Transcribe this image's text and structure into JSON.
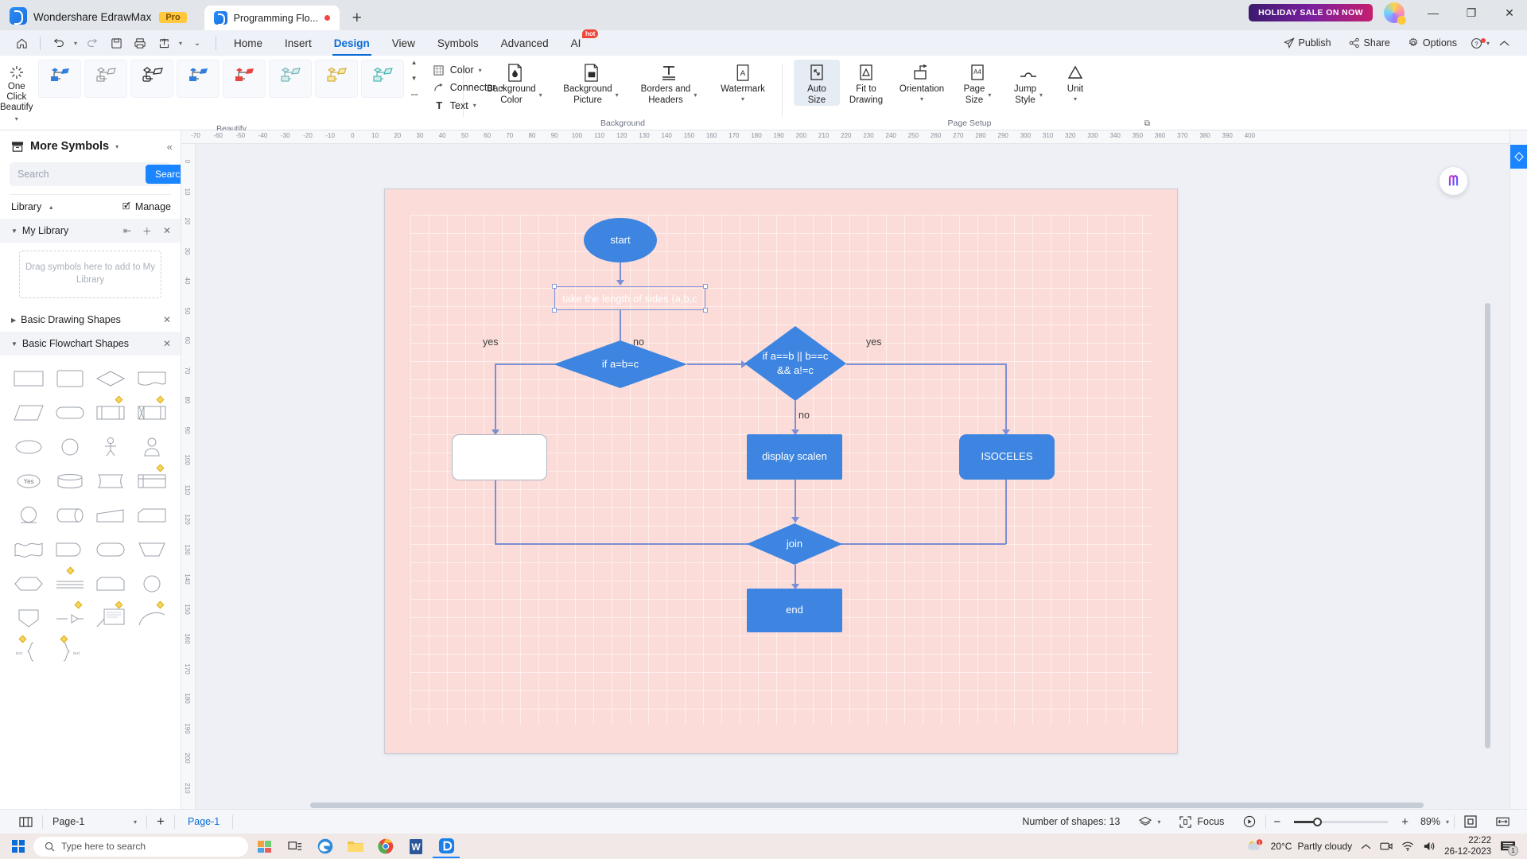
{
  "titlebar": {
    "app_name": "Wondershare EdrawMax",
    "pro_badge": "Pro",
    "doc_tab": "Programming Flo...",
    "new_tab": "+",
    "sale_badge": "HOLIDAY SALE ON NOW",
    "minimize": "—",
    "maximize": "❐",
    "close": "✕"
  },
  "menubar": {
    "quick_access": [
      "home-icon",
      "undo-icon",
      "redo-icon",
      "save-icon",
      "print-icon",
      "export-icon",
      "more-icon"
    ],
    "tabs": [
      {
        "label": "Home",
        "active": false
      },
      {
        "label": "Insert",
        "active": false
      },
      {
        "label": "Design",
        "active": true
      },
      {
        "label": "View",
        "active": false
      },
      {
        "label": "Symbols",
        "active": false
      },
      {
        "label": "Advanced",
        "active": false
      },
      {
        "label": "AI",
        "active": false,
        "badge": "hot"
      }
    ],
    "right_items": [
      {
        "label": "Publish",
        "icon": "publish-icon"
      },
      {
        "label": "Share",
        "icon": "share-icon"
      },
      {
        "label": "Options",
        "icon": "gear-icon"
      }
    ],
    "help_icon": "help-icon",
    "collapse_icon": "chevron-up-icon"
  },
  "ribbon": {
    "one_click": {
      "line1": "One Click",
      "line2": "Beautify",
      "icon": "sparkle-icon"
    },
    "beautify_group_title": "Beautify",
    "style_count": 8,
    "color_connector_text": [
      {
        "label": "Color",
        "icon": "color-grid-icon"
      },
      {
        "label": "Connector",
        "icon": "connector-icon"
      },
      {
        "label": "Text",
        "icon": "text-icon"
      }
    ],
    "background_group_title": "Background",
    "background_buttons": [
      {
        "l1": "Background",
        "l2": "Color",
        "icon": "bg-color-icon",
        "caret": true,
        "selected": false
      },
      {
        "l1": "Background",
        "l2": "Picture",
        "icon": "bg-picture-icon",
        "caret": true,
        "selected": false
      },
      {
        "l1": "Borders and",
        "l2": "Headers",
        "icon": "borders-headers-icon",
        "caret": true,
        "selected": false
      },
      {
        "l1": "Watermark",
        "l2": "",
        "icon": "watermark-icon",
        "caret": true,
        "selected": false
      }
    ],
    "page_setup_group_title": "Page Setup",
    "page_setup_buttons": [
      {
        "l1": "Auto",
        "l2": "Size",
        "icon": "auto-size-icon",
        "caret": false,
        "selected": true
      },
      {
        "l1": "Fit to",
        "l2": "Drawing",
        "icon": "fit-drawing-icon",
        "caret": false,
        "selected": false
      },
      {
        "l1": "Orientation",
        "l2": "",
        "icon": "orientation-icon",
        "caret": true,
        "selected": false
      },
      {
        "l1": "Page",
        "l2": "Size",
        "icon": "page-size-icon",
        "caret": true,
        "selected": false
      },
      {
        "l1": "Jump",
        "l2": "Style",
        "icon": "jump-style-icon",
        "caret": true,
        "selected": false
      },
      {
        "l1": "Unit",
        "l2": "",
        "icon": "unit-icon",
        "caret": true,
        "selected": false
      }
    ]
  },
  "left_panel": {
    "title": "More Symbols",
    "collapse_icon": "chevron-double-left-icon",
    "search_placeholder": "Search",
    "search_value": "",
    "search_button": "Search",
    "library_label": "Library",
    "manage_label": "Manage",
    "sections": [
      {
        "label": "My Library",
        "expanded": true,
        "shaded": true
      },
      {
        "label": "Basic Drawing Shapes",
        "expanded": false,
        "shaded": false
      },
      {
        "label": "Basic Flowchart Shapes",
        "expanded": true,
        "shaded": true
      }
    ],
    "drop_hint": "Drag symbols here to add to My Library",
    "shape_count": 36
  },
  "canvas": {
    "page_background": "#fbdcd8",
    "node_fill": "#3d85e0",
    "connector_color": "#7b8fd4",
    "ai_orb": "ai-icon",
    "ruler_h_ticks": [
      "-70",
      "-60",
      "-50",
      "-40",
      "-30",
      "-20",
      "-10",
      "0",
      "10",
      "20",
      "30",
      "40",
      "50",
      "60",
      "70",
      "80",
      "90",
      "100",
      "110",
      "120",
      "130",
      "140",
      "150",
      "160",
      "170",
      "180",
      "190",
      "200",
      "210",
      "220",
      "230",
      "240",
      "250",
      "260",
      "270",
      "280",
      "290",
      "300",
      "310",
      "320",
      "330",
      "340",
      "350",
      "360",
      "370",
      "380",
      "390",
      "400"
    ],
    "ruler_v_ticks": [
      "0",
      "10",
      "20",
      "30",
      "40",
      "50",
      "60",
      "70",
      "80",
      "90",
      "100",
      "110",
      "120",
      "130",
      "140",
      "150",
      "160",
      "170",
      "180",
      "190",
      "200",
      "210"
    ]
  },
  "flowchart": {
    "nodes": [
      {
        "id": "start",
        "label": "start",
        "shape": "ellipse"
      },
      {
        "id": "input",
        "label": "take the length of sides (a,b,c",
        "shape": "rect",
        "selected": true
      },
      {
        "id": "dec1",
        "label": "if a=b=c",
        "shape": "diamond"
      },
      {
        "id": "dec2",
        "label": "if a==b || b==c && a!=c",
        "shape": "diamond"
      },
      {
        "id": "empty",
        "label": "",
        "shape": "round-rect",
        "empty": true
      },
      {
        "id": "scalen",
        "label": "display scalen",
        "shape": "rect"
      },
      {
        "id": "isoceles",
        "label": "ISOCELES",
        "shape": "round-rect"
      },
      {
        "id": "join",
        "label": "join",
        "shape": "diamond"
      },
      {
        "id": "end",
        "label": "end",
        "shape": "rect"
      }
    ],
    "edge_labels": [
      {
        "text": "yes",
        "for": "dec1-left"
      },
      {
        "text": "no",
        "for": "dec1-right"
      },
      {
        "text": "yes",
        "for": "dec2-right"
      },
      {
        "text": "no",
        "for": "dec2-down"
      }
    ]
  },
  "color_strip": {
    "fill_icon": "fill-bucket-icon",
    "colors": [
      "#9b1b3a",
      "#c4162e",
      "#e23a4e",
      "#f07b85",
      "#f6b4b6",
      "#fcd9d8",
      "#1b6f8a",
      "#1f88aa",
      "#3aa8cc",
      "#7fcbe3",
      "#bfe4f1",
      "#e6f4fa",
      "#f24f1c",
      "#f4712c",
      "#f78f36",
      "#fbb03b",
      "#fdc76b",
      "#fde2a9",
      "#0f7a5f",
      "#169b6b",
      "#22b573",
      "#5fcf9b",
      "#9fe3c2",
      "#cdf0dd",
      "#8e1c5c",
      "#b12a6e",
      "#c94a8a",
      "#dd7fae",
      "#eab3cc",
      "#f5d9e5",
      "#3b2a7a",
      "#4a3a96",
      "#6355b5",
      "#8b80cc",
      "#b3aade",
      "#d8d3ef",
      "#6b4a1f",
      "#8a5f2a",
      "#a87a3d",
      "#c19a62",
      "#d7bb91",
      "#e9dac2",
      "#3f3f3f",
      "#5a5a5a",
      "#787878",
      "#9a9a9a",
      "#bcbcbc",
      "#dedede",
      "#2b2b2b",
      "#434343",
      "#616161",
      "#8a8a8a",
      "#b4b4b4",
      "#d8d8d8",
      "#e8e8e8",
      "#f4f4f4"
    ]
  },
  "status_bar": {
    "layout_icon": "layout-icon",
    "page_selector": "Page-1",
    "add_page": "+",
    "page_tab": "Page-1",
    "shapes_count_label": "Number of shapes: 13",
    "layers_icon": "layers-icon",
    "focus_label": "Focus",
    "presentation_icon": "play-icon",
    "zoom_out": "−",
    "zoom_in": "+",
    "zoom_level": "89%",
    "fit_page_icon": "fit-page-icon",
    "fit_width_icon": "fit-width-icon"
  },
  "taskbar": {
    "start_icon": "windows-icon",
    "search_placeholder": "Type here to search",
    "apps": [
      "task-view-icon",
      "edge-icon",
      "explorer-icon",
      "chrome-icon",
      "word-icon",
      "edraw-icon"
    ],
    "weather_temp": "20°C",
    "weather_desc": "Partly cloudy",
    "tray_icons": [
      "chevron-up-icon",
      "camera-icon",
      "wifi-icon",
      "volume-icon"
    ],
    "time": "22:22",
    "date": "26-12-2023",
    "notification_count": "1"
  }
}
